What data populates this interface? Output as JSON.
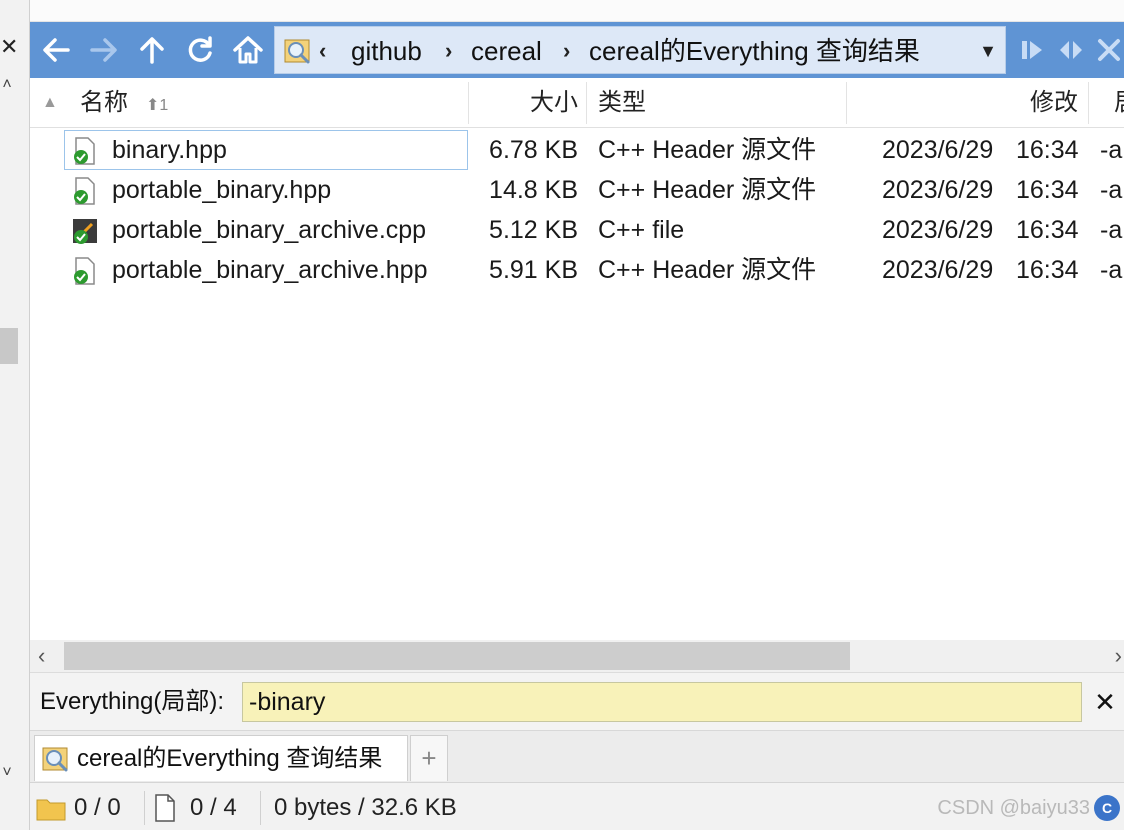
{
  "toolbar": {
    "back_icon": "arrow-left-icon",
    "forward_icon": "arrow-right-icon",
    "up_icon": "arrow-up-icon",
    "refresh_icon": "refresh-icon",
    "home_icon": "home-icon",
    "breadcrumb": [
      "github",
      "cereal",
      "cereal的Everything 查询结果"
    ]
  },
  "columns": {
    "name": "名称",
    "sort_hint": "⬆1",
    "size": "大小",
    "type": "类型",
    "modified": "修改",
    "attr": "居"
  },
  "files": [
    {
      "name": "binary.hpp",
      "size": "6.78 KB",
      "type": "C++ Header 源文件",
      "date": "2023/6/29",
      "time": "16:34",
      "attr": "-a",
      "icon": "header-file-icon",
      "selected": true
    },
    {
      "name": "portable_binary.hpp",
      "size": "14.8 KB",
      "type": "C++ Header 源文件",
      "date": "2023/6/29",
      "time": "16:34",
      "attr": "-a",
      "icon": "header-file-icon",
      "selected": false
    },
    {
      "name": "portable_binary_archive.cpp",
      "size": "5.12 KB",
      "type": "C++ file",
      "date": "2023/6/29",
      "time": "16:34",
      "attr": "-a",
      "icon": "cpp-file-icon",
      "selected": false
    },
    {
      "name": "portable_binary_archive.hpp",
      "size": "5.91 KB",
      "type": "C++ Header 源文件",
      "date": "2023/6/29",
      "time": "16:34",
      "attr": "-a",
      "icon": "header-file-icon",
      "selected": false
    }
  ],
  "filter": {
    "label": "Everything(局部):",
    "value": "-binary"
  },
  "tabs": [
    {
      "label": "cereal的Everything 查询结果",
      "icon": "search-folder-icon"
    }
  ],
  "tab_add_label": "+",
  "status": {
    "folders": "0 / 0",
    "files": "0 / 4",
    "bytes": "0 bytes / 32.6 KB",
    "watermark": "CSDN @baiyu33"
  },
  "colors": {
    "toolbar_bg": "#5f94d4",
    "address_bg": "#dde8f7",
    "filter_bg": "#f8f2b9"
  }
}
